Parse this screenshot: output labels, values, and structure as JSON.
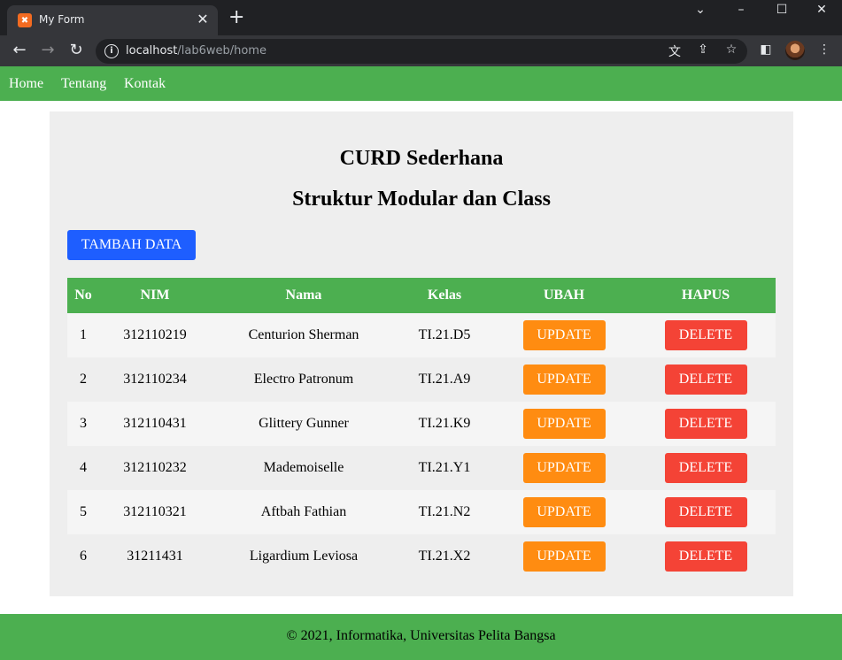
{
  "browser": {
    "tab_title": "My Form",
    "url_host": "localhost",
    "url_path": "/lab6web/home"
  },
  "nav": {
    "items": [
      "Home",
      "Tentang",
      "Kontak"
    ]
  },
  "page": {
    "title": "CURD Sederhana",
    "subtitle": "Struktur Modular dan Class",
    "add_button": "TAMBAH DATA"
  },
  "table": {
    "headers": [
      "No",
      "NIM",
      "Nama",
      "Kelas",
      "UBAH",
      "HAPUS"
    ],
    "update_label": "UPDATE",
    "delete_label": "DELETE",
    "rows": [
      {
        "no": "1",
        "nim": "312110219",
        "nama": "Centurion Sherman",
        "kelas": "TI.21.D5"
      },
      {
        "no": "2",
        "nim": "312110234",
        "nama": "Electro Patronum",
        "kelas": "TI.21.A9"
      },
      {
        "no": "3",
        "nim": "312110431",
        "nama": "Glittery Gunner",
        "kelas": "TI.21.K9"
      },
      {
        "no": "4",
        "nim": "312110232",
        "nama": "Mademoiselle",
        "kelas": "TI.21.Y1"
      },
      {
        "no": "5",
        "nim": "312110321",
        "nama": "Aftbah Fathian",
        "kelas": "TI.21.N2"
      },
      {
        "no": "6",
        "nim": "31211431",
        "nama": "Ligardium Leviosa",
        "kelas": "TI.21.X2"
      }
    ]
  },
  "footer": {
    "text": "© 2021, Informatika, Universitas Pelita Bangsa"
  },
  "colors": {
    "green": "#4caf50",
    "blue_button": "#1e5eff",
    "update_button": "#ff8c11",
    "delete_button": "#f44336"
  }
}
